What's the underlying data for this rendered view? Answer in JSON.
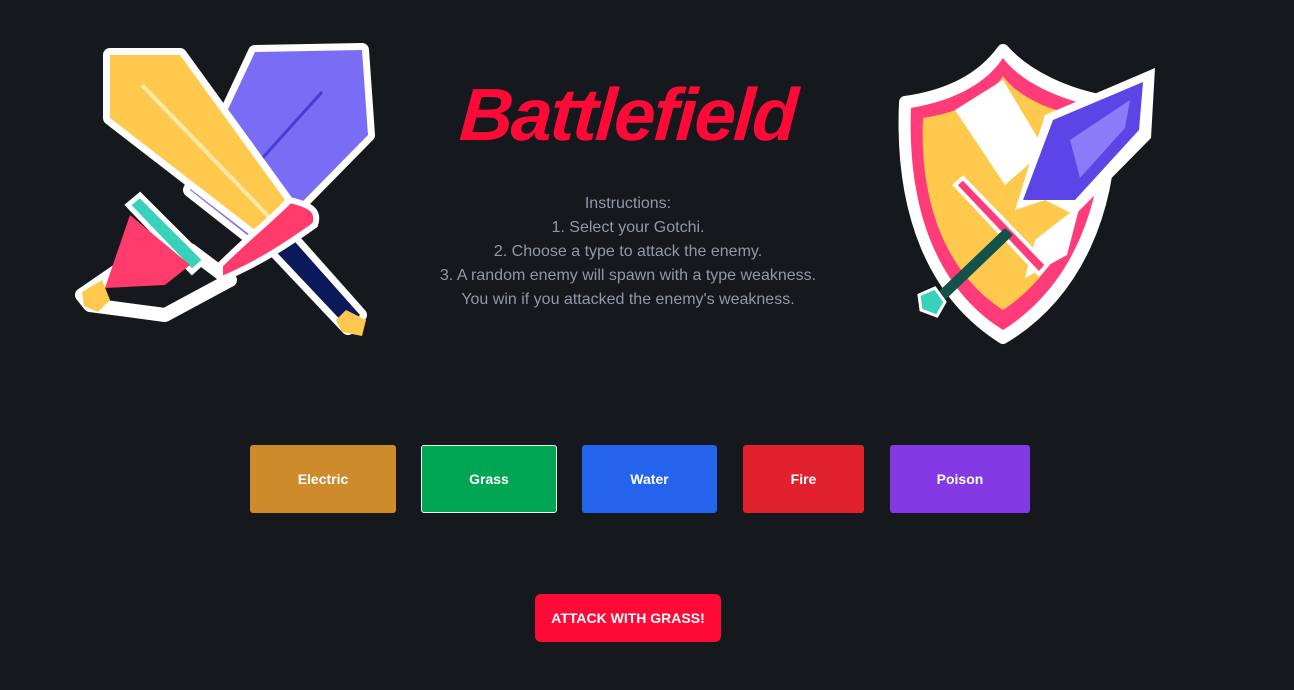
{
  "title": "Battlefield",
  "instructions": {
    "heading": "Instructions:",
    "lines": [
      "1. Select your Gotchi.",
      "2. Choose a type to attack the enemy.",
      "3. A random enemy will spawn with a type weakness.",
      "You win if you attacked the enemy's weakness."
    ]
  },
  "types": [
    {
      "label": "Electric",
      "color": "#cd8b2b",
      "selected": false
    },
    {
      "label": "Grass",
      "color": "#00a651",
      "selected": true
    },
    {
      "label": "Water",
      "color": "#2463eb",
      "selected": false
    },
    {
      "label": "Fire",
      "color": "#e1222e",
      "selected": false
    },
    {
      "label": "Poison",
      "color": "#833ae4",
      "selected": false
    }
  ],
  "attack_button": {
    "label": "ATTACK WITH GRASS!",
    "color": "#ff0a36"
  },
  "icons": {
    "left": "crossed-swords-icon",
    "right": "shield-sword-icon"
  }
}
